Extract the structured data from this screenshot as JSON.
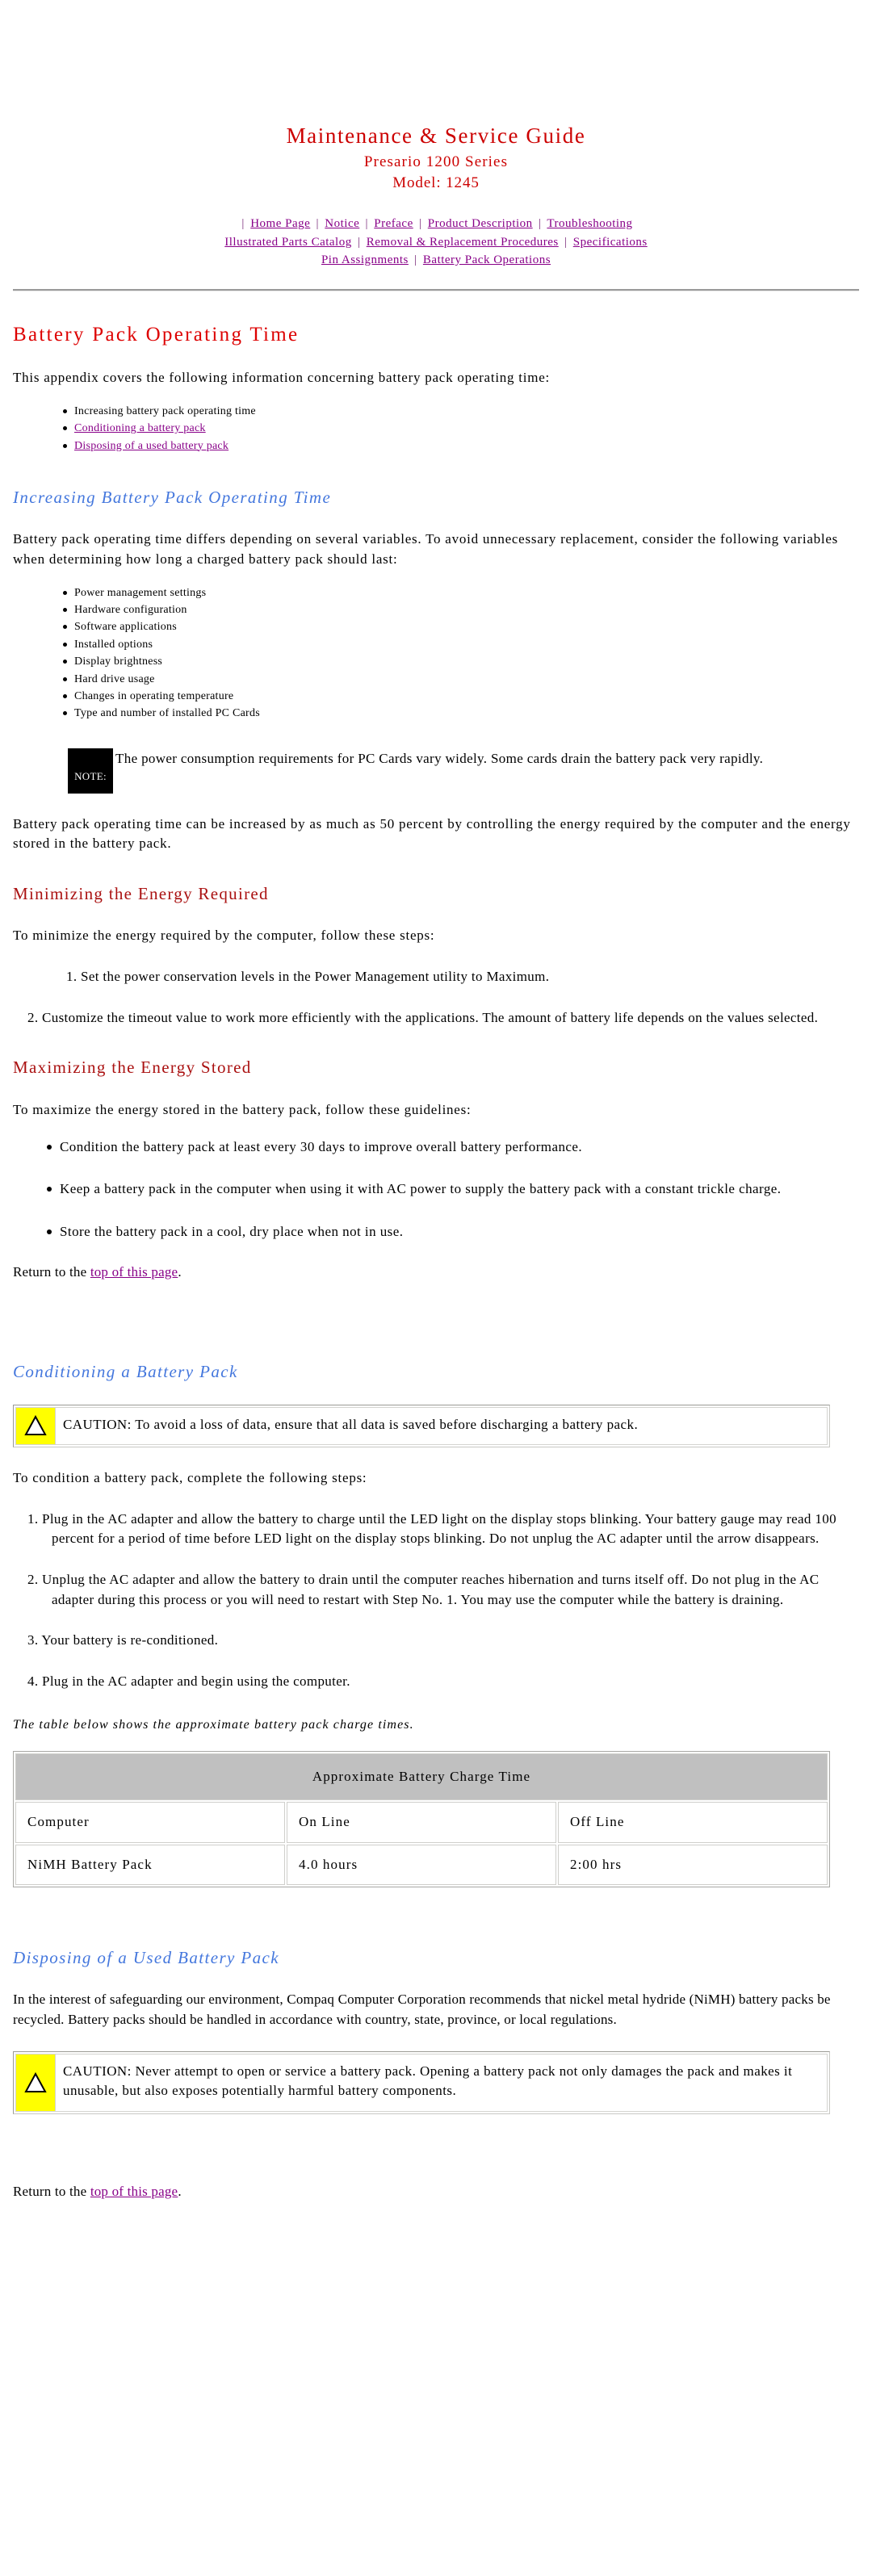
{
  "header": {
    "title": "Maintenance & Service Guide",
    "subtitle": "Presario 1200 Series",
    "model": "Model: 1245",
    "nav_rows": [
      [
        "Home Page",
        "Notice",
        "Preface",
        "Product Description",
        "Troubleshooting"
      ],
      [
        "Illustrated Parts Catalog",
        "Removal & Replacement Procedures",
        "Specifications"
      ],
      [
        "Pin Assignments",
        "Battery Pack Operations"
      ]
    ]
  },
  "page": {
    "title": "Battery Pack Operating Time",
    "intro": "This appendix covers the following information concerning battery pack operating time:",
    "toc": [
      {
        "label": "Increasing battery pack operating time",
        "is_link": false
      },
      {
        "label": "Conditioning a battery pack",
        "is_link": true
      },
      {
        "label": "Disposing of a used battery pack",
        "is_link": true
      }
    ]
  },
  "increasing": {
    "heading": "Increasing Battery Pack Operating Time",
    "paragraph": "Battery pack operating time differs depending on several variables. To avoid unnecessary replacement, consider the following variables when determining how long a charged battery pack should last:",
    "variables": [
      "Power management settings",
      "Hardware configuration",
      "Software applications",
      "Installed options",
      "Display brightness",
      "Hard drive usage",
      "Changes in operating temperature",
      "Type and number of installed PC Cards"
    ],
    "note": {
      "badge": "NOTE:",
      "text": "The power consumption requirements for PC Cards vary widely. Some cards drain the battery pack very rapidly."
    },
    "closing": "Battery pack operating time can be increased by as much as 50 percent by controlling the energy required by the computer and the energy stored in the battery pack."
  },
  "minimizing": {
    "heading": "Minimizing the Energy Required",
    "lead": "To minimize the energy required by the computer, follow these steps:",
    "steps": [
      "1. Set the power conservation levels in the Power Management utility to Maximum.",
      "2. Customize the timeout value to work more efficiently with the applications. The amount of battery life depends on the values selected."
    ]
  },
  "maximizing": {
    "heading": "Maximizing the Energy Stored",
    "lead": "To maximize the energy stored in the battery pack, follow these guidelines:",
    "guidelines": [
      "Condition the battery pack at least every 30 days to improve overall battery performance.",
      "Keep a battery pack in the computer when using it with AC power to supply the battery pack with a constant trickle charge.",
      "Store the battery pack in a cool, dry place when not in use."
    ],
    "return_prefix": "Return to the ",
    "return_link": "top of this page",
    "return_suffix": "."
  },
  "conditioning": {
    "heading": "Conditioning a Battery Pack",
    "caution": {
      "icon": "warning-triangle-icon",
      "text": "CAUTION:  To avoid a loss of data, ensure that all data is saved before discharging a battery pack."
    },
    "lead": "To condition a battery pack, complete the following steps:",
    "steps": [
      "1. Plug in the AC adapter and allow the battery to charge until the LED light on the display stops blinking. Your battery gauge may read 100 percent for a period of time before LED light on the display stops blinking. Do not unplug the AC adapter until the arrow disappears.",
      "2. Unplug the AC adapter and allow the battery to drain until the computer reaches hibernation and turns itself off. Do not plug in the AC adapter during this process or you will need to restart with Step No. 1. You may use the computer while the battery is draining.",
      "3. Your battery is re-conditioned.",
      "4. Plug in the AC adapter and begin using the computer."
    ],
    "table_caption": "The table below shows the approximate battery pack charge times."
  },
  "charge_table": {
    "title": "Approximate Battery Charge Time",
    "columns": [
      "Computer",
      "On Line",
      "Off Line"
    ],
    "rows": [
      [
        "NiMH Battery Pack",
        "4.0 hours",
        "2:00 hrs"
      ]
    ]
  },
  "disposing": {
    "heading": "Disposing of a Used Battery Pack",
    "paragraph": "In the interest of safeguarding our environment, Compaq Computer Corporation recommends that nickel metal hydride (NiMH) battery packs be recycled. Battery packs should be handled in accordance with country, state, province, or local regulations.",
    "caution": {
      "icon": "warning-triangle-icon",
      "text": "CAUTION:  Never attempt to open or service a battery pack. Opening a battery pack not only damages the pack and makes it unusable, but also exposes potentially harmful battery components."
    },
    "return_prefix": "Return to the ",
    "return_link": "top of this page",
    "return_suffix": "."
  },
  "colors": {
    "title_red": "#cc0000",
    "heading_red": "#dd0000",
    "heading_blue": "#4477dd",
    "subheading_red": "#aa1111",
    "link_purple": "#880088",
    "caution_yellow": "#ffff00",
    "table_header_gray": "#c0c0c0"
  }
}
